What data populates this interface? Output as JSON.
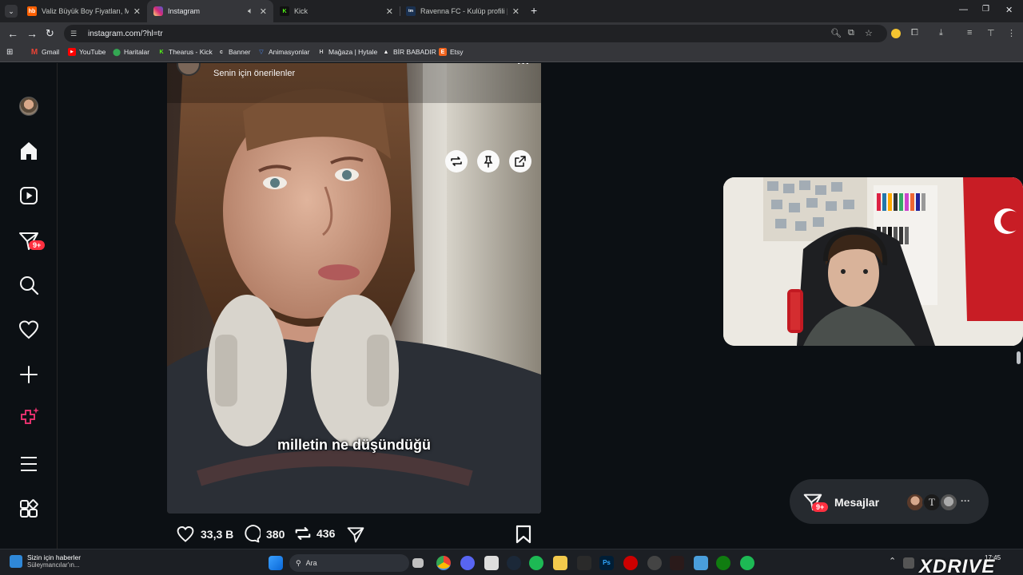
{
  "browser": {
    "tabs": [
      {
        "title": "Valiz Büyük Boy Fiyatları, Model",
        "favicon": "hb",
        "color": "#ff6000"
      },
      {
        "title": "Instagram",
        "favicon": "instagram",
        "color": "#d6249f"
      },
      {
        "title": "Kick",
        "favicon": "kick",
        "color": "#53fc18"
      },
      {
        "title": "Ravenna FC - Kulüp profili | Trans",
        "favicon": "tm",
        "color": "#1a3151"
      }
    ],
    "url": "instagram.com/?hl=tr",
    "bookmarks": [
      {
        "label": "Gmail",
        "icon": "gmail-icon",
        "color": "#ea4335"
      },
      {
        "label": "YouTube",
        "icon": "youtube-icon",
        "color": "#ff0000"
      },
      {
        "label": "Haritalar",
        "icon": "maps-icon",
        "color": "#34a853"
      },
      {
        "label": "Thearus - Kick",
        "icon": "kick-icon",
        "color": "#53fc18"
      },
      {
        "label": "Banner",
        "icon": "banner-icon",
        "color": "#dddddd"
      },
      {
        "label": "Animasyonlar",
        "icon": "animasyon-icon",
        "color": "#4c8bf5"
      },
      {
        "label": "Mağaza | Hytale",
        "icon": "hytale-icon",
        "color": "#cccccc"
      },
      {
        "label": "BİR BABADIR",
        "icon": "birbabadir-icon",
        "color": "#ffffff"
      },
      {
        "label": "Etsy",
        "icon": "etsy-icon",
        "color": "#f1641e"
      }
    ]
  },
  "instagram": {
    "notification_badge": "9+",
    "reel": {
      "suggested_label": "Senin için önerilenler",
      "caption": "milletin ne düşündüğü",
      "likes": "33,3 B",
      "comments": "380",
      "reposts": "436"
    },
    "messages": {
      "label": "Mesajlar",
      "badge": "9+"
    }
  },
  "taskbar": {
    "news_title": "Sizin için haberler",
    "news_sub": "Süleymancılar'ın...",
    "search_placeholder": "Ara",
    "clock": "17:45",
    "watermark": "XDRIVE"
  }
}
